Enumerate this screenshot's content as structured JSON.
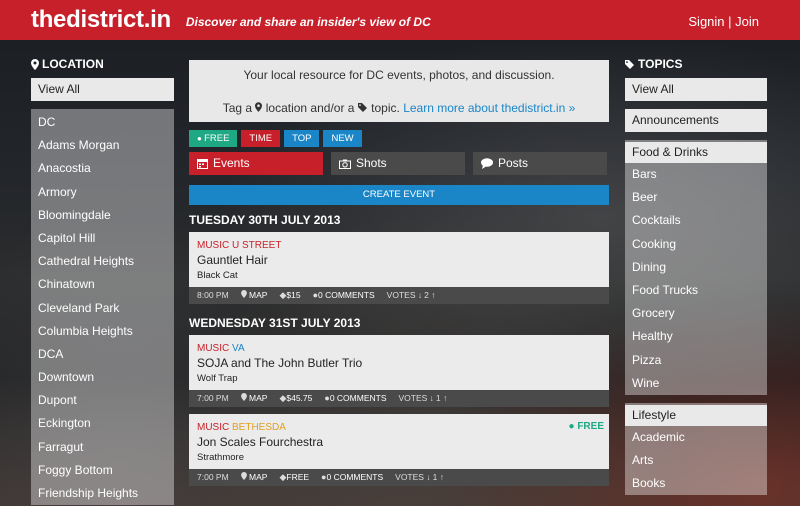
{
  "header": {
    "logo": "thedistrict.in",
    "tagline": "Discover and share an insider's view of DC",
    "signin": "Signin",
    "separator": " | ",
    "join": "Join",
    "brand_color": "#c8202a"
  },
  "location": {
    "title": "LOCATION",
    "view_all": "View All",
    "items": [
      "DC",
      "Adams Morgan",
      "Anacostia",
      "Armory",
      "Bloomingdale",
      "Capitol Hill",
      "Cathedral Heights",
      "Chinatown",
      "Cleveland Park",
      "Columbia Heights",
      "DCA",
      "Downtown",
      "Dupont",
      "Eckington",
      "Farragut",
      "Foggy Bottom",
      "Friendship Heights"
    ]
  },
  "topics": {
    "title": "TOPICS",
    "view_all": "View All",
    "announcements": "Announcements",
    "food_head": "Food & Drinks",
    "food_items": [
      "Bars",
      "Beer",
      "Cocktails",
      "Cooking",
      "Dining",
      "Food Trucks",
      "Grocery",
      "Healthy",
      "Pizza",
      "Wine"
    ],
    "lifestyle_head": "Lifestyle",
    "lifestyle_items": [
      "Academic",
      "Arts",
      "Books"
    ]
  },
  "intro": {
    "line1": "Your local resource for DC events, photos, and discussion.",
    "line2_a": "Tag a",
    "line2_b": "location and/or a",
    "line2_c": "topic.",
    "learn_more": "Learn more about thedistrict.in »"
  },
  "filters": [
    {
      "label": "FREE",
      "color": "#1fa884"
    },
    {
      "label": "TIME",
      "color": "#c8202a"
    },
    {
      "label": "TOP",
      "color": "#1a86c7"
    },
    {
      "label": "NEW",
      "color": "#1a86c7"
    }
  ],
  "tabs": {
    "events": "Events",
    "shots": "Shots",
    "posts": "Posts"
  },
  "create_event": "CREATE EVENT",
  "days": [
    {
      "date": "TUESDAY 30TH JULY 2013",
      "events": [
        {
          "category": "MUSIC",
          "location": "U STREET",
          "location_color": "#c8202a",
          "title": "Gauntlet Hair",
          "venue": "Black Cat",
          "free_badge": "",
          "time": "8:00 PM",
          "map": "MAP",
          "price": "$15",
          "comments": "0 COMMENTS",
          "votes_label": "VOTES",
          "votes": "2"
        }
      ]
    },
    {
      "date": "WEDNESDAY 31ST JULY 2013",
      "events": [
        {
          "category": "MUSIC",
          "location": "VA",
          "location_color": "#1a86c7",
          "title": "SOJA and The John Butler Trio",
          "venue": "Wolf Trap",
          "free_badge": "",
          "time": "7:00 PM",
          "map": "MAP",
          "price": "$45.75",
          "comments": "0 COMMENTS",
          "votes_label": "VOTES",
          "votes": "1"
        },
        {
          "category": "MUSIC",
          "location": "BETHESDA",
          "location_color": "#e0a020",
          "title": "Jon Scales Fourchestra",
          "venue": "Strathmore",
          "free_badge": "FREE",
          "time": "7:00 PM",
          "map": "MAP",
          "price": "FREE",
          "comments": "0 COMMENTS",
          "votes_label": "VOTES",
          "votes": "1"
        }
      ]
    }
  ]
}
